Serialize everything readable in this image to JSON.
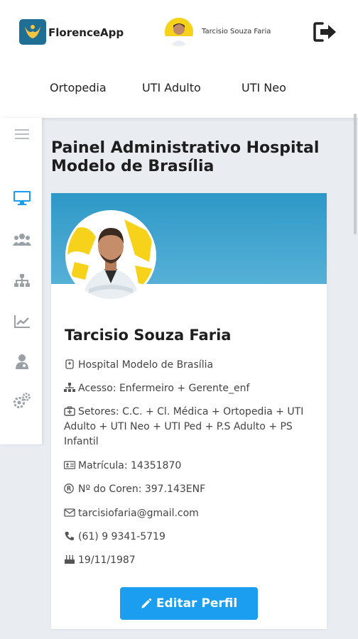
{
  "header": {
    "brand": "FlorenceApp",
    "user_name": "Tarcisio Souza Faria",
    "tabs": [
      "Ortopedia",
      "UTI Adulto",
      "UTI Neo"
    ]
  },
  "sidebar": {
    "items": [
      {
        "icon": "menu-icon"
      },
      {
        "icon": "monitor-icon",
        "active": true
      },
      {
        "icon": "users-icon"
      },
      {
        "icon": "org-chart-icon"
      },
      {
        "icon": "chart-line-icon"
      },
      {
        "icon": "doctor-icon"
      },
      {
        "icon": "gears-icon"
      }
    ]
  },
  "main": {
    "title": "Painel Administrativo Hospital Modelo de Brasília"
  },
  "profile": {
    "name": "Tarcisio Souza Faria",
    "hospital": "Hospital Modelo de Brasília",
    "access": "Acesso: Enfermeiro + Gerente_enf",
    "sectors": "Setores: C.C. + Cl. Médica + Ortopedia + UTI Adulto + UTI Neo + UTI Ped + P.S Adulto + PS Infantil",
    "registration": "Matrícula: 14351870",
    "coren": "Nº do Coren: 397.143ENF",
    "email": "tarcisiofaria@gmail.com",
    "phone": "(61) 9 9341-5719",
    "birthdate": "19/11/1987",
    "edit_label": "Editar Perfil"
  },
  "colors": {
    "accent": "#1b9ef0",
    "banner": "#2e98c7",
    "active_icon": "#1b9ef0",
    "icon_gray": "#9aa0a6"
  }
}
